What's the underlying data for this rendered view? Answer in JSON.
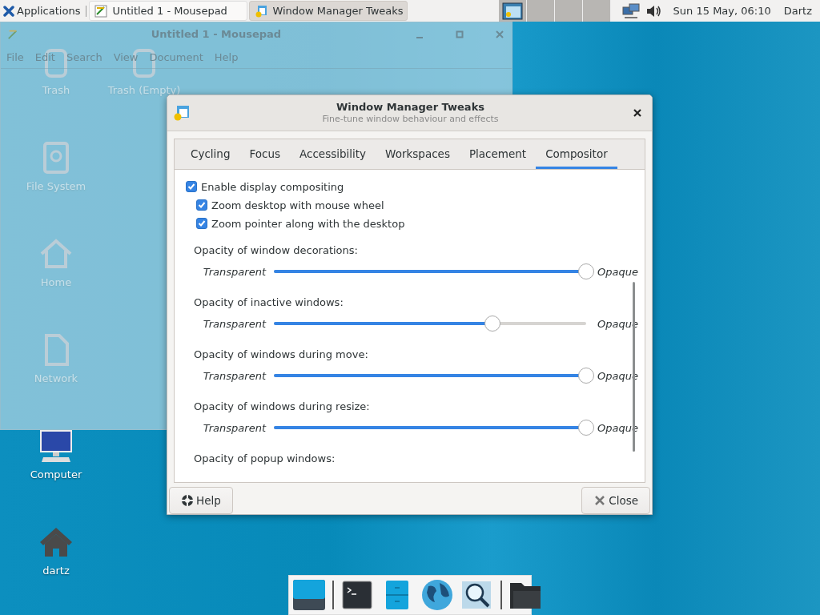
{
  "top_panel": {
    "applications": "Applications",
    "tasks": [
      {
        "title": "Untitled 1 - Mousepad",
        "kind": "editor",
        "selected": false
      },
      {
        "title": "Window Manager Tweaks",
        "kind": "tweaks",
        "selected": true
      }
    ],
    "clock": "Sun 15 May, 06:10",
    "user": "Dartz"
  },
  "desktop_icons": [
    {
      "label": "Trash",
      "kind": "trash"
    },
    {
      "label": "Trash (Empty)",
      "kind": "trash"
    },
    {
      "label": "File System",
      "kind": "drive"
    },
    {
      "label": "Home",
      "kind": "home"
    },
    {
      "label": "Network",
      "kind": "file"
    },
    {
      "label": "Computer",
      "kind": "computer"
    },
    {
      "label": "dartz",
      "kind": "user_home"
    }
  ],
  "mousepad_window": {
    "title": "Untitled 1 - Mousepad",
    "menu": [
      "File",
      "Edit",
      "Search",
      "View",
      "Document",
      "Help"
    ]
  },
  "dialog": {
    "title": "Window Manager Tweaks",
    "subtitle": "Fine-tune window behaviour and effects",
    "tabs": [
      {
        "label": "Cycling",
        "selected": false
      },
      {
        "label": "Focus",
        "selected": false
      },
      {
        "label": "Accessibility",
        "selected": false
      },
      {
        "label": "Workspaces",
        "selected": false
      },
      {
        "label": "Placement",
        "selected": false
      },
      {
        "label": "Compositor",
        "selected": true
      }
    ],
    "options": [
      {
        "label": "Enable display compositing",
        "checked": true,
        "children": [
          {
            "label": "Zoom desktop with mouse wheel",
            "checked": true
          },
          {
            "label": "Zoom pointer along with the desktop",
            "checked": true
          }
        ]
      }
    ],
    "sections": [
      {
        "label": "Opacity of window decorations:",
        "min_label": "Transparent",
        "max_label": "Opaque",
        "level": 1
      },
      {
        "label": "Opacity of inactive windows:",
        "min_label": "Transparent",
        "max_label": "Opaque",
        "level": 0.7
      },
      {
        "label": "Opacity of windows during move:",
        "min_label": "Transparent",
        "max_label": "Opaque",
        "level": 1
      },
      {
        "label": "Opacity of windows during resize:",
        "min_label": "Transparent",
        "max_label": "Opaque",
        "level": 1
      },
      {
        "label": "Opacity of popup windows:"
      }
    ],
    "buttons": [
      {
        "label": "Help",
        "kind": "help"
      },
      {
        "label": "Close",
        "kind": "close"
      }
    ]
  }
}
